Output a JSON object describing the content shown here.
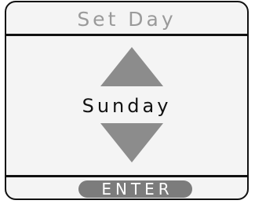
{
  "header": {
    "title": "Set Day"
  },
  "selector": {
    "value": "Sunday",
    "up_icon": "triangle-up-icon",
    "down_icon": "triangle-down-icon"
  },
  "footer": {
    "enter_label": "ENTER"
  },
  "colors": {
    "title_text": "#9a9a9a",
    "arrow_fill": "#8c8c8c",
    "button_fill": "#7c7c7c",
    "button_text": "#ffffff",
    "panel_background": "#f4f4f4",
    "border": "#111111"
  }
}
